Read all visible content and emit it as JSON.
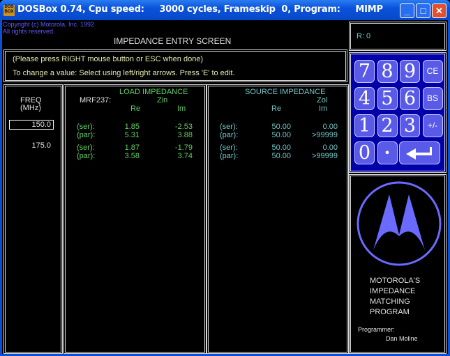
{
  "titlebar": {
    "text": "DOSBox 0.74, Cpu speed:     3000 cycles, Frameskip  0, Program:     MIMP",
    "icon": "DOS BOX"
  },
  "copyright": [
    "Copyright (c) Motorola, Inc. 1992",
    "All rights reserved."
  ],
  "screen_title": "IMPEDANCE ENTRY SCREEN",
  "instructions": [
    "(Please press RIGHT mouse button or ESC when done)",
    "To change a value: Select using left/right arrows. Press 'E' to edit."
  ],
  "freq": {
    "header1": "FREQ",
    "header2": "(MHz)",
    "values": [
      "150.0",
      "175.0"
    ]
  },
  "load": {
    "device": "MRF237:",
    "title": "LOAD IMPEDANCE",
    "sub": "Zin",
    "re": "Re",
    "im": "Im",
    "rows": [
      {
        "label": "(ser):",
        "re": "1.85",
        "im": "-2.53"
      },
      {
        "label": "(par):",
        "re": "5.31",
        "im": "3.88"
      },
      {
        "label": "(ser):",
        "re": "1.87",
        "im": "-1.79"
      },
      {
        "label": "(par):",
        "re": "3.58",
        "im": "3.74"
      }
    ]
  },
  "source": {
    "title": "SOURCE IMPEDANCE",
    "sub": "Zol",
    "re": "Re",
    "im": "Im",
    "rows": [
      {
        "label": "(ser):",
        "re": "50.00",
        "im": "0.00"
      },
      {
        "label": "(par):",
        "re": "50.00",
        "im": ">99999"
      },
      {
        "label": "(ser):",
        "re": "50.00",
        "im": "0.00"
      },
      {
        "label": "(par):",
        "re": "50.00",
        "im": ">99999"
      }
    ]
  },
  "register": "R: 0",
  "keypad": [
    "7",
    "8",
    "9",
    "CE",
    "4",
    "5",
    "6",
    "BS",
    "1",
    "2",
    "3",
    "+/-",
    "0",
    "•"
  ],
  "logo_text": [
    "MOTOROLA'S",
    "IMPEDANCE",
    "MATCHING",
    "PROGRAM"
  ],
  "programmer_label": "Programmer:",
  "programmer_name": "Dan Moline"
}
